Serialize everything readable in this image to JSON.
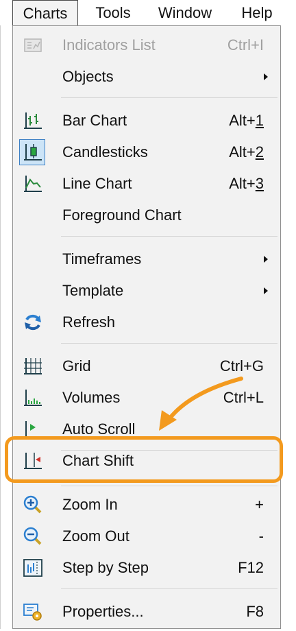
{
  "menubar": {
    "items": [
      {
        "label": "Charts"
      },
      {
        "label": "Tools"
      },
      {
        "label": "Window"
      },
      {
        "label": "Help"
      }
    ]
  },
  "menu": {
    "items": [
      {
        "label": "Indicators List",
        "shortcut": "Ctrl+I",
        "disabled": true,
        "icon": "indicators-list-icon"
      },
      {
        "label": "Objects",
        "submenu": true
      },
      {
        "label": "Bar Chart",
        "shortcut_prefix": "Alt+",
        "shortcut_key": "1",
        "icon": "bar-chart-icon"
      },
      {
        "label": "Candlesticks",
        "shortcut_prefix": "Alt+",
        "shortcut_key": "2",
        "icon": "candlesticks-icon",
        "checked": true
      },
      {
        "label": "Line Chart",
        "shortcut_prefix": "Alt+",
        "shortcut_key": "3",
        "icon": "line-chart-icon"
      },
      {
        "label": "Foreground Chart"
      },
      {
        "label": "Timeframes",
        "submenu": true
      },
      {
        "label": "Template",
        "submenu": true
      },
      {
        "label": "Refresh",
        "icon": "refresh-icon"
      },
      {
        "label": "Grid",
        "shortcut": "Ctrl+G",
        "icon": "grid-icon"
      },
      {
        "label": "Volumes",
        "shortcut": "Ctrl+L",
        "icon": "volumes-icon"
      },
      {
        "label": "Auto Scroll",
        "icon": "auto-scroll-icon"
      },
      {
        "label": "Chart Shift",
        "icon": "chart-shift-icon",
        "highlighted": true
      },
      {
        "label": "Zoom In",
        "shortcut": "+",
        "icon": "zoom-in-icon"
      },
      {
        "label": "Zoom Out",
        "shortcut": "-",
        "icon": "zoom-out-icon"
      },
      {
        "label": "Step by Step",
        "shortcut": "F12",
        "icon": "step-by-step-icon"
      },
      {
        "label": "Properties...",
        "shortcut": "F8",
        "icon": "properties-icon"
      }
    ]
  },
  "colors": {
    "highlight": "#f39a1e",
    "menu_bg": "#f2f2f2",
    "checked_bg": "#cce4f7",
    "checked_border": "#3c7fc4"
  }
}
